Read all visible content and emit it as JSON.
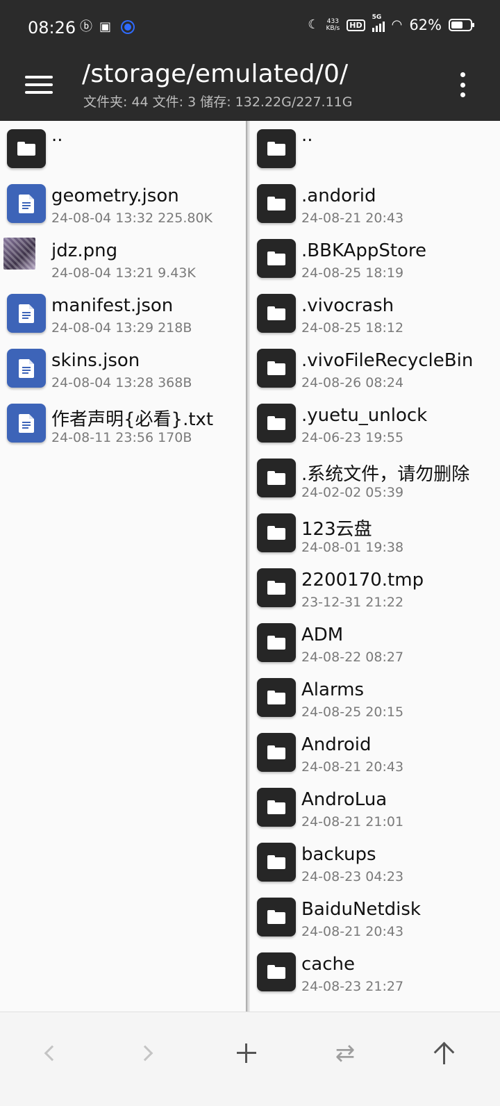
{
  "status_bar": {
    "time": "08:26",
    "left_icons": [
      "bilibili-icon",
      "app-icon",
      "blue-dot-icon"
    ],
    "net_speed_value": "433",
    "net_speed_unit": "KB/s",
    "hd_label": "HD",
    "network_label": "5G",
    "battery_percent": "62%",
    "battery_level": 0.62
  },
  "toolbar": {
    "path": "/storage/emulated/0/",
    "stats": "文件夹: 44  文件: 3  储存: 132.22G/227.11G"
  },
  "left_pane": {
    "parent_label": "..",
    "items": [
      {
        "name": "geometry.json",
        "meta": "24-08-04 13:32  225.80K",
        "type": "doc"
      },
      {
        "name": "jdz.png",
        "meta": "24-08-04 13:21  9.43K",
        "type": "image"
      },
      {
        "name": "manifest.json",
        "meta": "24-08-04 13:29  218B",
        "type": "doc"
      },
      {
        "name": "skins.json",
        "meta": "24-08-04 13:28  368B",
        "type": "doc"
      },
      {
        "name": "作者声明{必看}.txt",
        "meta": "24-08-11 23:56  170B",
        "type": "doc"
      }
    ]
  },
  "right_pane": {
    "parent_label": "..",
    "items": [
      {
        "name": ".andorid",
        "meta": "24-08-21 20:43"
      },
      {
        "name": ".BBKAppStore",
        "meta": "24-08-25 18:19"
      },
      {
        "name": ".vivocrash",
        "meta": "24-08-25 18:12"
      },
      {
        "name": ".vivoFileRecycleBin",
        "meta": "24-08-26 08:24"
      },
      {
        "name": ".yuetu_unlock",
        "meta": "24-06-23 19:55"
      },
      {
        "name": ".系统文件，请勿删除",
        "meta": "24-02-02 05:39"
      },
      {
        "name": "123云盘",
        "meta": "24-08-01 19:38"
      },
      {
        "name": "2200170.tmp",
        "meta": "23-12-31 21:22"
      },
      {
        "name": "ADM",
        "meta": "24-08-22 08:27"
      },
      {
        "name": "Alarms",
        "meta": "24-08-25 20:15"
      },
      {
        "name": "Android",
        "meta": "24-08-21 20:43"
      },
      {
        "name": "AndroLua",
        "meta": "24-08-21 21:01"
      },
      {
        "name": "backups",
        "meta": "24-08-23 04:23"
      },
      {
        "name": "BaiduNetdisk",
        "meta": "24-08-21 20:43"
      },
      {
        "name": "cache",
        "meta": "24-08-23 21:27"
      }
    ]
  },
  "bottom_bar": {
    "buttons": [
      "back",
      "forward",
      "add",
      "swap",
      "up"
    ],
    "swap_glyph": "⇄"
  },
  "colors": {
    "toolbar_bg": "#2b2b2b",
    "folder_icon_bg": "#262626",
    "doc_icon_bg": "#3d64b8"
  }
}
